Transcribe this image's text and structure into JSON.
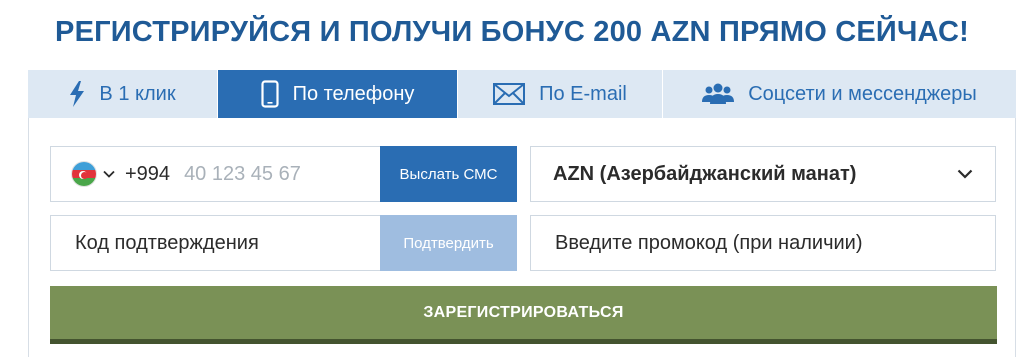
{
  "headline": "РЕГИСТРИРУЙСЯ И ПОЛУЧИ БОНУС 200 AZN ПРЯМО СЕЙЧАС!",
  "tabs": [
    {
      "label": "В 1 клик",
      "icon": "lightning-icon",
      "active": false
    },
    {
      "label": "По телефону",
      "icon": "smartphone-icon",
      "active": true
    },
    {
      "label": "По E-mail",
      "icon": "envelope-icon",
      "active": false
    },
    {
      "label": "Соцсети и мессенджеры",
      "icon": "people-icon",
      "active": false
    }
  ],
  "phone": {
    "country_flag": "azerbaijan-flag-icon",
    "dial_code": "+994",
    "placeholder": "40 123 45 67",
    "value": "",
    "send_sms_label": "Выслать СМС"
  },
  "currency": {
    "selected": "AZN (Азербайджанский манат)"
  },
  "confirmation": {
    "placeholder": "Код подтверждения",
    "value": "",
    "confirm_label": "Подтвердить"
  },
  "promo": {
    "placeholder": "Введите промокод (при наличии)",
    "value": ""
  },
  "register_label": "ЗАРЕГИСТРИРОВАТЬСЯ",
  "colors": {
    "primary_blue": "#2a6db3",
    "tab_bg": "#dde8f3",
    "disabled_blue": "#9fbde0",
    "register_green": "#7a9156",
    "headline_blue": "#1f5a96"
  }
}
